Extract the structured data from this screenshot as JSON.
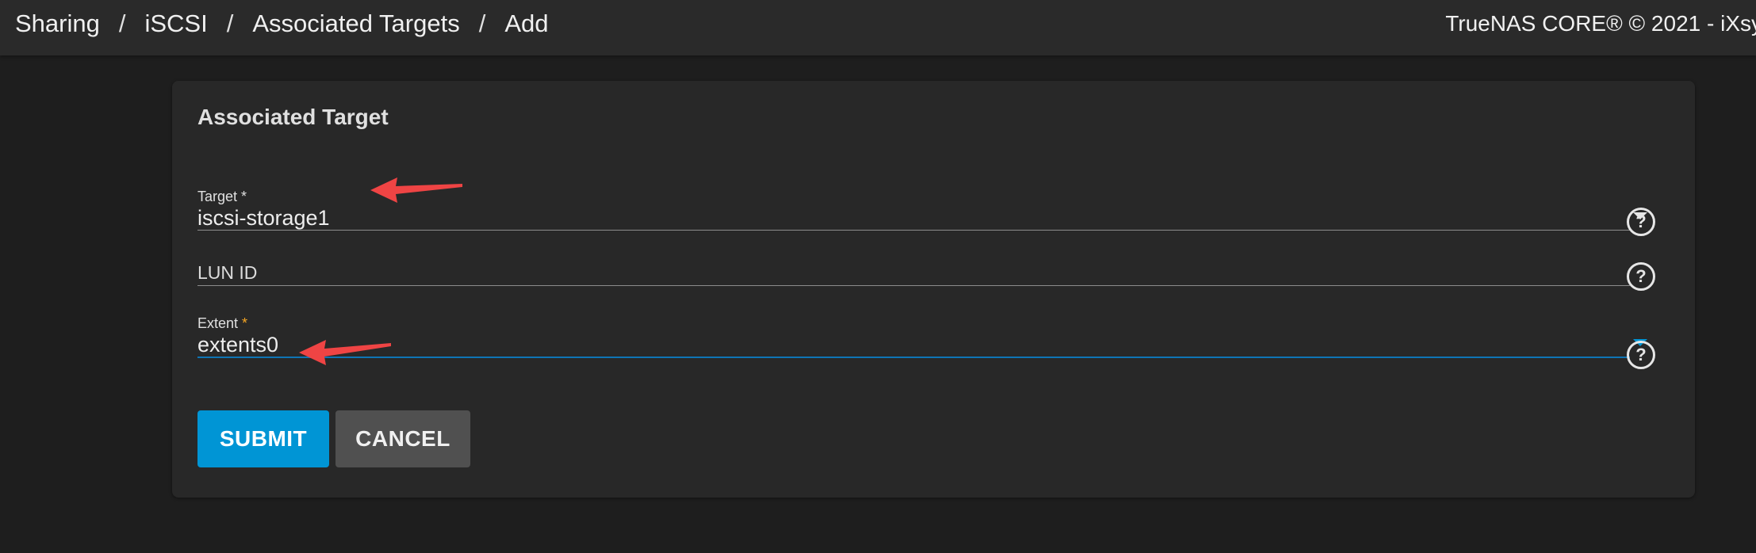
{
  "breadcrumb": {
    "items": [
      "Sharing",
      "iSCSI",
      "Associated Targets",
      "Add"
    ],
    "separator": "/"
  },
  "header": {
    "copyright": "TrueNAS CORE® © 2021 - iXsy"
  },
  "form": {
    "title": "Associated Target",
    "target": {
      "label": "Target",
      "required_mark": "*",
      "value": "iscsi-storage1"
    },
    "lun_id": {
      "placeholder": "LUN ID",
      "value": ""
    },
    "extent": {
      "label": "Extent",
      "required_mark": "*",
      "value": "extents0"
    },
    "help_icon": "?",
    "submit_label": "SUBMIT",
    "cancel_label": "CANCEL"
  },
  "colors": {
    "accent": "#0095d5",
    "annotation_arrow": "#ef4444",
    "required_focus": "#f5a623"
  }
}
